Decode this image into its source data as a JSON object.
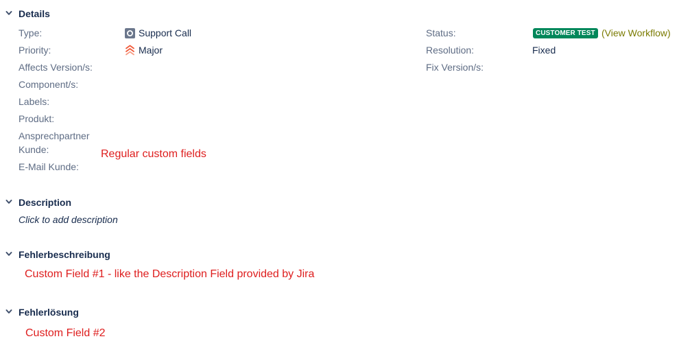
{
  "sections": {
    "details": {
      "title": "Details",
      "left": {
        "type": {
          "label": "Type:",
          "value": "Support Call",
          "icon": "support-call-icon"
        },
        "priority": {
          "label": "Priority:",
          "value": "Major",
          "icon": "priority-major-icon"
        },
        "affects_version": {
          "label": "Affects Version/s:"
        },
        "components": {
          "label": "Component/s:"
        },
        "labels": {
          "label": "Labels:"
        },
        "produkt": {
          "label": "Produkt:"
        },
        "ansprechpartner": {
          "label_line1": "Ansprechpartner",
          "label_line2": "Kunde:"
        },
        "email": {
          "label": "E-Mail Kunde:"
        }
      },
      "right": {
        "status": {
          "label": "Status:",
          "badge": "CUSTOMER TEST",
          "badge_color": "#00875a",
          "workflow_link": "View Workflow",
          "workflow_open": "(",
          "workflow_close": ")"
        },
        "resolution": {
          "label": "Resolution:",
          "value": "Fixed"
        },
        "fix_version": {
          "label": "Fix Version/s:"
        }
      }
    },
    "description": {
      "title": "Description",
      "placeholder": "Click to add description"
    },
    "fehlerbeschreibung": {
      "title": "Fehlerbeschreibung"
    },
    "fehlerloesung": {
      "title": "Fehlerlösung"
    }
  },
  "annotations": {
    "regular": "Regular custom fields",
    "field1": "Custom Field #1 - like the Description Field provided by Jira",
    "field2": "Custom Field #2",
    "color": "#de1d1d"
  }
}
